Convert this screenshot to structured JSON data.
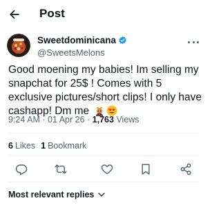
{
  "header": {
    "title": "Post"
  },
  "author": {
    "display_name": "Sweetdominicana",
    "handle": "@SweetsMelons",
    "verified": true
  },
  "post": {
    "text": "Good moening my babies! Im selling my snapchat for 25$ ! Comes with 5 exclusive pictures/short clips! I only have cashapp! Dm me",
    "emojis": [
      "person-with-crown-emoji",
      "smiling-face-with-heart-eyes-emoji"
    ]
  },
  "meta": {
    "time": "9:24 AM",
    "date": "01 Apr 26",
    "separator": "·",
    "views_count": "1,763",
    "views_label": "Views"
  },
  "stats": {
    "likes_count": "6",
    "likes_label": "Likes",
    "bookmarks_count": "1",
    "bookmarks_label": "Bookmark"
  },
  "actions": [
    "reply-icon",
    "repost-icon",
    "like-icon",
    "bookmark-icon",
    "share-icon"
  ],
  "replies": {
    "sort_label": "Most relevant replies"
  },
  "colors": {
    "text": "#0f1419",
    "secondary": "#536471",
    "divider": "#eff3f4",
    "verified": "#1d9bf0"
  }
}
